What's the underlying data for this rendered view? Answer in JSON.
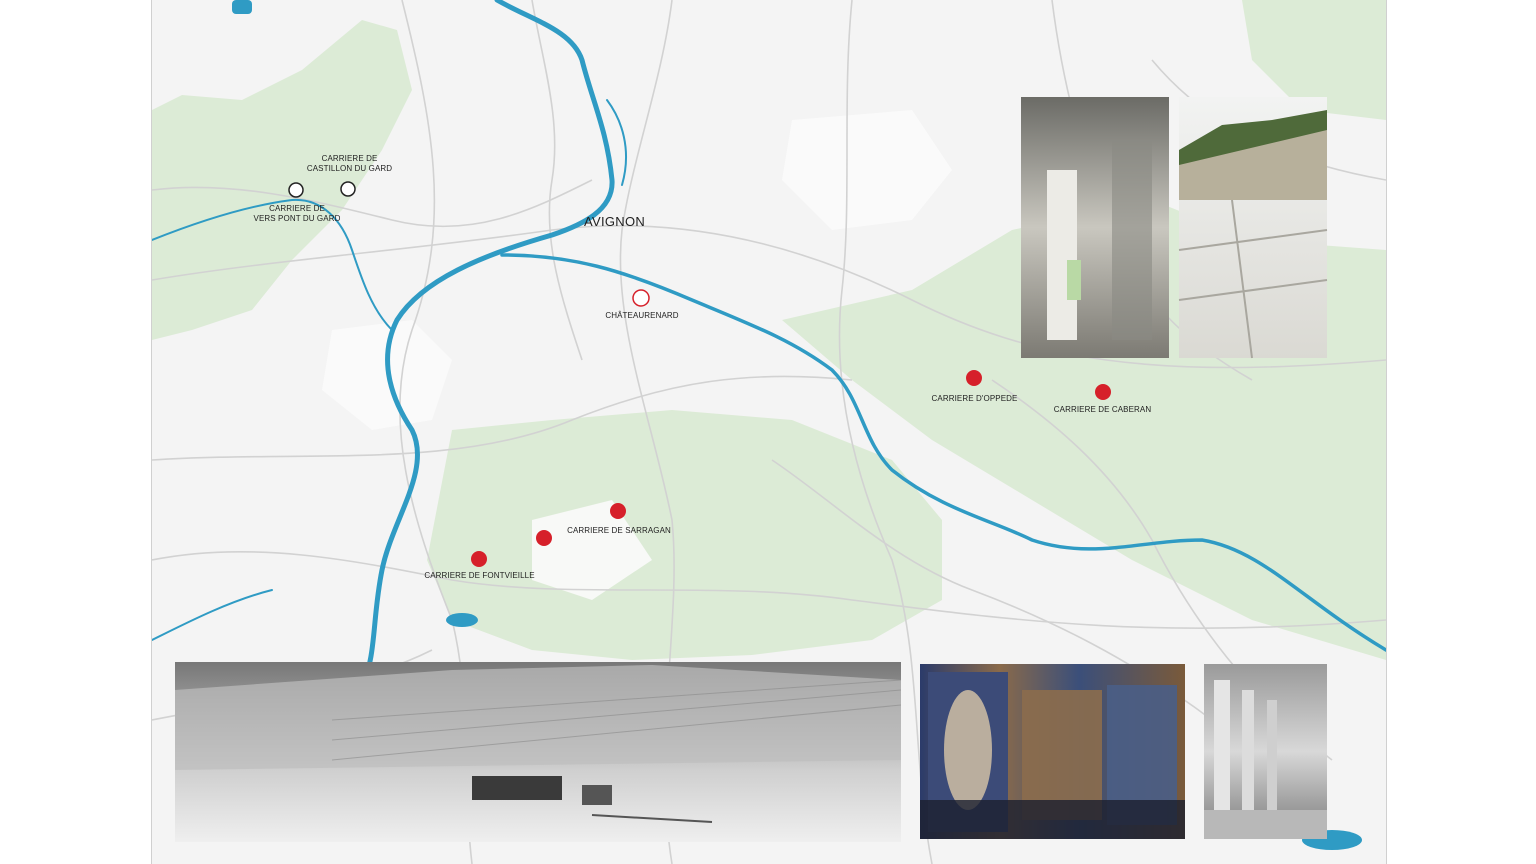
{
  "map": {
    "city": "AVIGNON",
    "colors": {
      "background": "#f4f4f4",
      "forest": "#dcebd6",
      "river": "#2f9bc4",
      "road": "#d6d6d6",
      "quarry_marker": "#d6202a",
      "town_marker": "#d6202a",
      "other_marker": "#222222"
    },
    "markers": [
      {
        "id": "vers",
        "label_line1": "CARRIERE DE",
        "label_line2": "VERS PONT DU GARD",
        "style": "hollow-black"
      },
      {
        "id": "castillon",
        "label_line1": "CARRIERE DE",
        "label_line2": "CASTILLON DU GARD",
        "style": "hollow-black"
      },
      {
        "id": "chateaurenard",
        "label_line1": "CHÂTEAURENARD",
        "label_line2": "",
        "style": "hollow-red"
      },
      {
        "id": "oppede",
        "label_line1": "CARRIERE D'OPPEDE",
        "label_line2": "",
        "style": "filled-red"
      },
      {
        "id": "caberan",
        "label_line1": "CARRIERE DE CABERAN",
        "label_line2": "",
        "style": "filled-red"
      },
      {
        "id": "sarragan",
        "label_line1": "CARRIERE DE SARRAGAN",
        "label_line2": "",
        "style": "filled-red"
      },
      {
        "id": "unnamed",
        "label_line1": "",
        "label_line2": "",
        "style": "filled-red"
      },
      {
        "id": "fontvieille",
        "label_line1": "CARRIERE DE FONTVIEILLE",
        "label_line2": "",
        "style": "filled-red"
      }
    ]
  },
  "photos": [
    {
      "id": "cave-interior",
      "icon": "quarry-cave-photo"
    },
    {
      "id": "open-quarry",
      "icon": "open-quarry-photo"
    },
    {
      "id": "panorama",
      "icon": "quarry-panorama-photo"
    },
    {
      "id": "projection-hall",
      "icon": "art-projection-photo"
    },
    {
      "id": "pillar-hall",
      "icon": "quarry-pillars-photo"
    }
  ]
}
